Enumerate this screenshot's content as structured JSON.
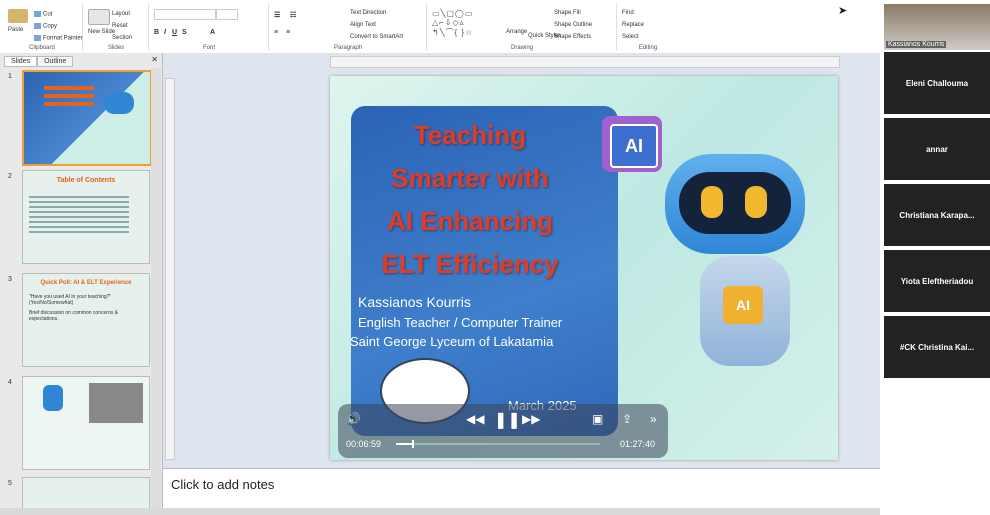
{
  "ribbon": {
    "clipboard": {
      "paste": "Paste",
      "cut": "Cut",
      "copy": "Copy",
      "format_painter": "Format Painter",
      "label": "Clipboard"
    },
    "slides": {
      "new_slide": "New Slide",
      "layout": "Layout",
      "reset": "Reset",
      "section": "Section",
      "label": "Slides"
    },
    "font": {
      "label": "Font"
    },
    "paragraph": {
      "text_direction": "Text Direction",
      "align_text": "Align Text",
      "convert_smartart": "Convert to SmartArt",
      "label": "Paragraph"
    },
    "drawing": {
      "arrange": "Arrange",
      "quick_styles": "Quick Styles",
      "shape_fill": "Shape Fill",
      "shape_outline": "Shape Outline",
      "shape_effects": "Shape Effects",
      "label": "Drawing"
    },
    "editing": {
      "find": "Find",
      "replace": "Replace",
      "select": "Select",
      "label": "Editing"
    }
  },
  "panel": {
    "tabs": [
      "Slides",
      "Outline"
    ],
    "slides": [
      {
        "num": "1",
        "title": ""
      },
      {
        "num": "2",
        "title": "Table of Contents"
      },
      {
        "num": "3",
        "title": "Quick Poll: AI & ELT Experience",
        "bullets": [
          "\"Have you used AI in your teaching?\" (Yes/No/Somewhat)",
          "Brief discussion on common concerns & expectations."
        ]
      },
      {
        "num": "4",
        "title": ""
      },
      {
        "num": "5",
        "title": ""
      }
    ]
  },
  "slide": {
    "title_lines": [
      "Teaching",
      "Smarter with",
      "AI Enhancing",
      "ELT Efficiency"
    ],
    "author": "Kassianos Kourris",
    "role": "English Teacher / Computer Trainer",
    "school": "Saint George Lyceum of Lakatamia",
    "date_partial": "March 2025",
    "chip_label": "AI"
  },
  "media": {
    "current": "00:06:59",
    "duration": "01:27:40",
    "progress": 0.08
  },
  "notes": {
    "placeholder": "Click to add notes"
  },
  "participants": {
    "host_name": "Kassianos Kourris",
    "tiles": [
      "Eleni Challouma",
      "annar",
      "Christiana Karapa...",
      "Yiota Eleftheriadou",
      "#CK Christina Kai..."
    ]
  }
}
